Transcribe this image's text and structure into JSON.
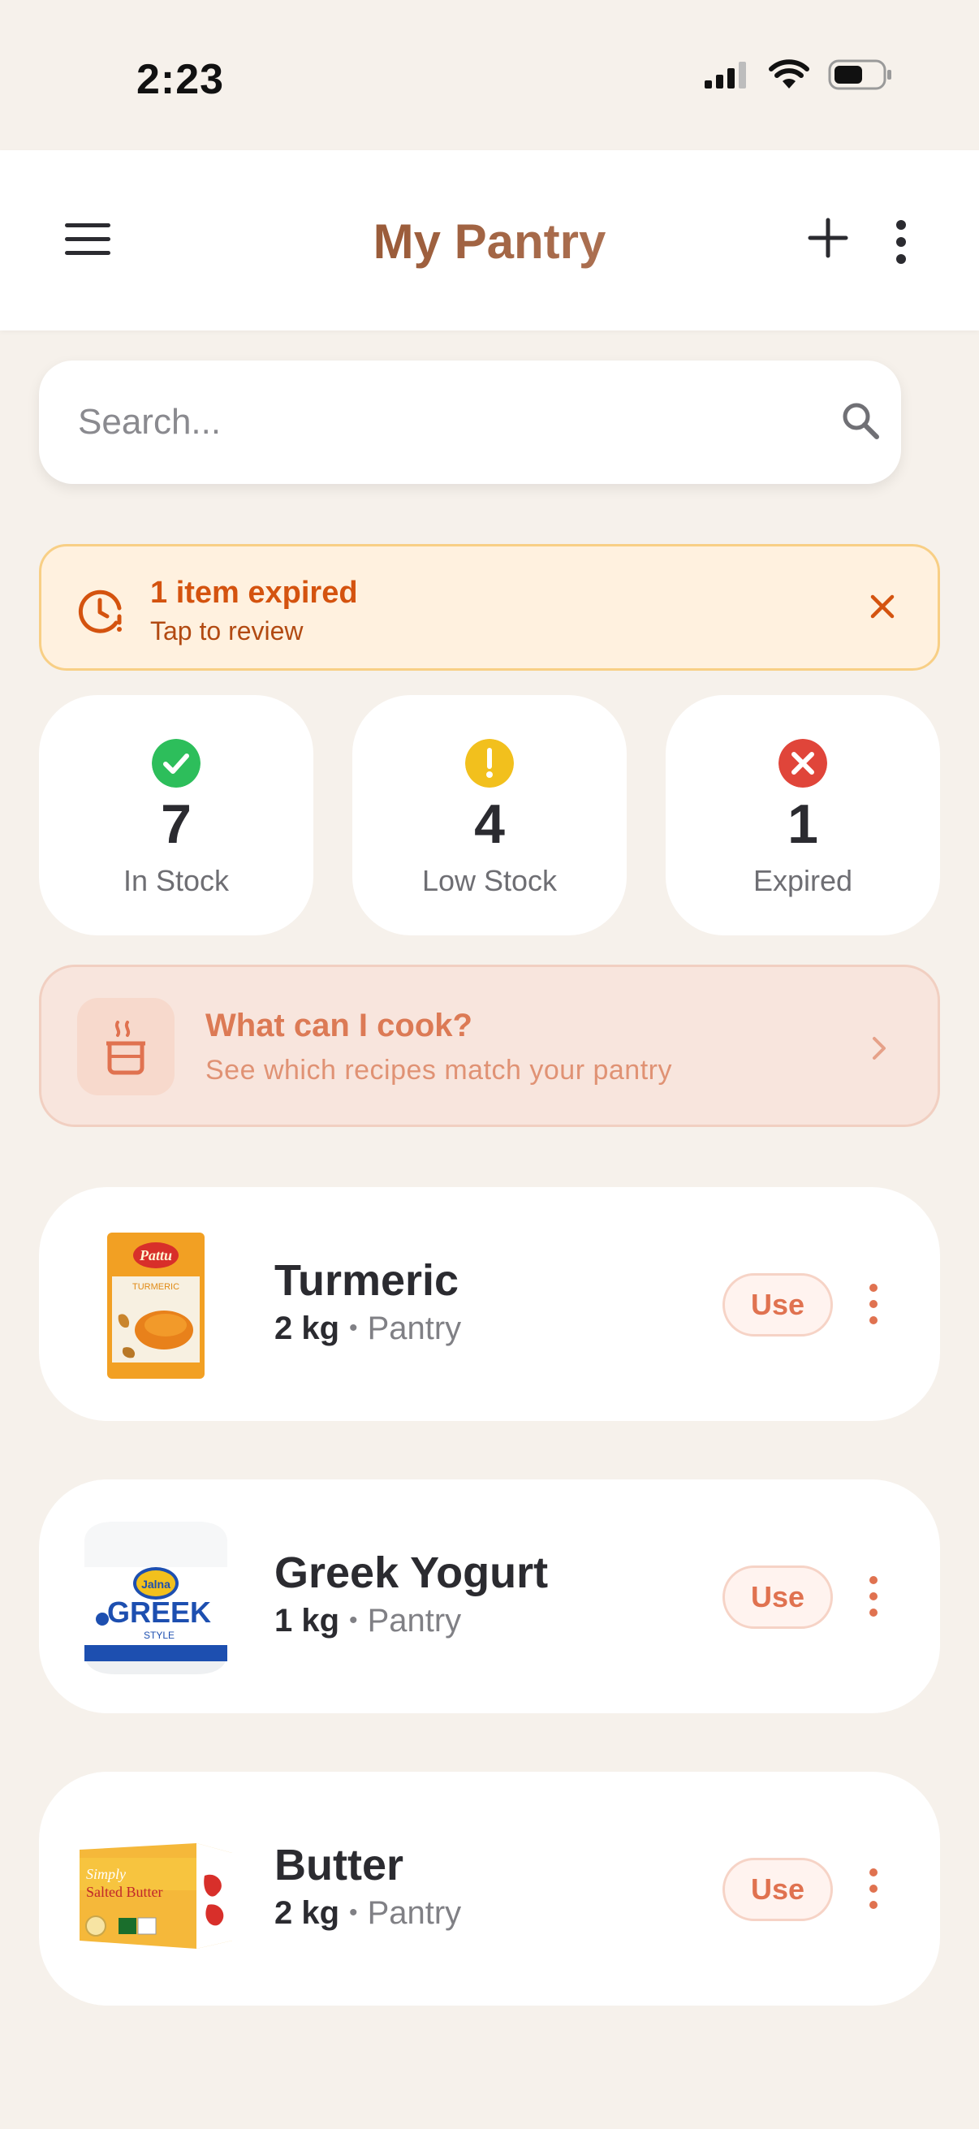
{
  "status_bar": {
    "time": "2:23"
  },
  "header": {
    "title": "My Pantry"
  },
  "search": {
    "placeholder": "Search..."
  },
  "banner": {
    "title": "1 item expired",
    "subtitle": "Tap to review"
  },
  "stats": [
    {
      "value": "7",
      "label": "In Stock",
      "color": "#2dbe5b"
    },
    {
      "value": "4",
      "label": "Low Stock",
      "color": "#f2c01d"
    },
    {
      "value": "1",
      "label": "Expired",
      "color": "#e0453a"
    }
  ],
  "cook": {
    "title": "What can I cook?",
    "subtitle": "See which recipes match your pantry"
  },
  "items": [
    {
      "name": "Turmeric",
      "qty": "2 kg",
      "location": "Pantry",
      "action": "Use"
    },
    {
      "name": "Greek Yogurt",
      "qty": "1 kg",
      "location": "Pantry",
      "action": "Use"
    },
    {
      "name": "Butter",
      "qty": "2 kg",
      "location": "Pantry",
      "action": "Use"
    }
  ],
  "colors": {
    "accent": "#e07250",
    "warning": "#d4530f",
    "background": "#f6f1eb"
  }
}
